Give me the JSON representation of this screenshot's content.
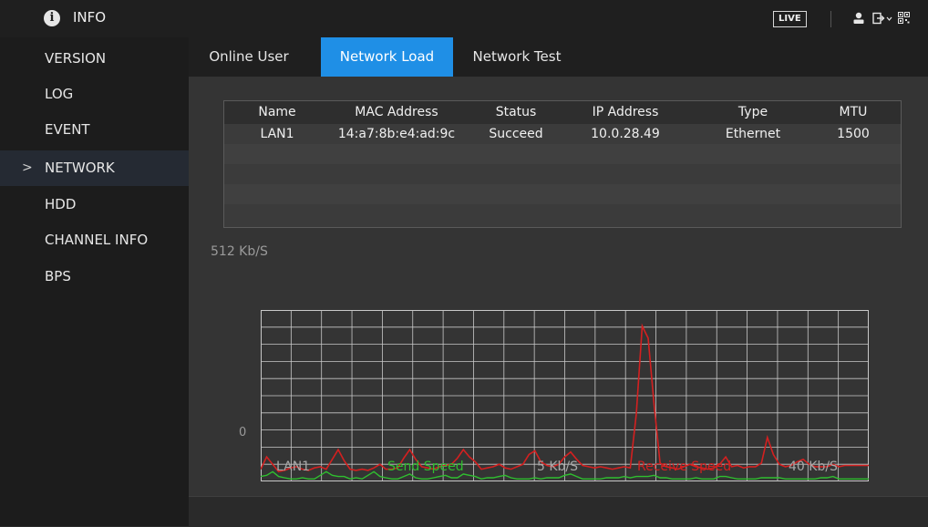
{
  "header": {
    "title": "INFO",
    "live_label": "LIVE"
  },
  "icons": {
    "info": "info-icon",
    "user": "user-icon",
    "logout": "logout-icon",
    "qr": "qr-code-icon",
    "chevron": "chevron-right-icon"
  },
  "sidebar": {
    "items": [
      {
        "label": "VERSION"
      },
      {
        "label": "LOG"
      },
      {
        "label": "EVENT"
      },
      {
        "label": "NETWORK",
        "active": true,
        "marker": ">"
      },
      {
        "label": "HDD"
      },
      {
        "label": "CHANNEL INFO"
      },
      {
        "label": "BPS"
      }
    ]
  },
  "tabs": [
    {
      "label": "Online User"
    },
    {
      "label": "Network Load",
      "active": true
    },
    {
      "label": "Network Test"
    }
  ],
  "table": {
    "headers": [
      "Name",
      "MAC Address",
      "Status",
      "IP Address",
      "Type",
      "MTU"
    ],
    "rows": [
      [
        "LAN1",
        "14:a7:8b:e4:ad:9c",
        "Succeed",
        "10.0.28.49",
        "Ethernet",
        "1500"
      ]
    ]
  },
  "graph": {
    "max_label": "512 Kb/S",
    "zero_label": "0",
    "colors": {
      "send": "#2fbf2f",
      "receive": "#d42020",
      "grid": "#c8c8c8"
    },
    "send_series": [
      4,
      5,
      8,
      4,
      3,
      2,
      2,
      3,
      2,
      2,
      5,
      8,
      5,
      4,
      4,
      2,
      3,
      2,
      5,
      8,
      4,
      3,
      2,
      2,
      4,
      6,
      3,
      2,
      2,
      3,
      4,
      5,
      3,
      3,
      6,
      5,
      4,
      2,
      3,
      3,
      4,
      5,
      3,
      2,
      2,
      2,
      3,
      2,
      3,
      3,
      3,
      5,
      6,
      4,
      2,
      2,
      2,
      2,
      3,
      3,
      3,
      4,
      3,
      4,
      4,
      4,
      5,
      3,
      3,
      2,
      2,
      2,
      2,
      3,
      2,
      2,
      2,
      4,
      4,
      3,
      2,
      2,
      2,
      2,
      3,
      3,
      3,
      3,
      2,
      2,
      2,
      2,
      2,
      2,
      3,
      3,
      4,
      2,
      2,
      2,
      2,
      2,
      2
    ],
    "receive_series": [
      10,
      20,
      14,
      8,
      9,
      11,
      12,
      10,
      9,
      11,
      12,
      10,
      18,
      26,
      17,
      10,
      9,
      10,
      9,
      11,
      14,
      10,
      10,
      11,
      19,
      26,
      18,
      12,
      11,
      10,
      12,
      13,
      14,
      19,
      26,
      20,
      16,
      10,
      11,
      12,
      14,
      11,
      10,
      12,
      14,
      22,
      25,
      16,
      13,
      12,
      14,
      20,
      24,
      18,
      13,
      12,
      11,
      12,
      11,
      10,
      11,
      12,
      11,
      55,
      127,
      117,
      62,
      15,
      12,
      11,
      10,
      12,
      14,
      12,
      11,
      10,
      11,
      14,
      20,
      12,
      13,
      11,
      12,
      12,
      15,
      36,
      22,
      14,
      12,
      13,
      16,
      18,
      14,
      12,
      12,
      12,
      14,
      12,
      13,
      13,
      13,
      13,
      13
    ]
  },
  "legend": {
    "interface": "LAN1",
    "send_label": "Send Speed",
    "send_value": "5 Kb/S",
    "receive_label": "Receive Speed",
    "receive_value": "40 Kb/S"
  }
}
